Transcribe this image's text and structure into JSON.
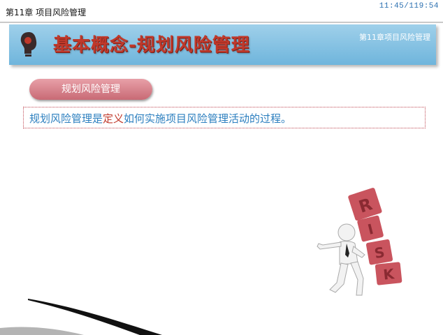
{
  "header": {
    "chapter_label": "第11章 项目风险管理",
    "slide_counter": "11:45/119:54"
  },
  "banner": {
    "title": "基本概念-规划风险管理",
    "chapter_label": "第11章项目风险管理",
    "icon": "bulb-head-icon"
  },
  "section": {
    "label": "规划风险管理"
  },
  "definition": {
    "before": "规划风险管理是",
    "highlight": "定义",
    "after": "如何实施项目风险管理活动的过程。"
  },
  "illustration": {
    "word": "RISK",
    "letters": [
      "R",
      "I",
      "S",
      "K"
    ]
  },
  "colors": {
    "banner_blue": "#7ec0e4",
    "title_red": "#c0392b",
    "pill_pink": "#d9818b",
    "text_blue": "#2c7fbf",
    "highlight_red": "#c0392b"
  }
}
